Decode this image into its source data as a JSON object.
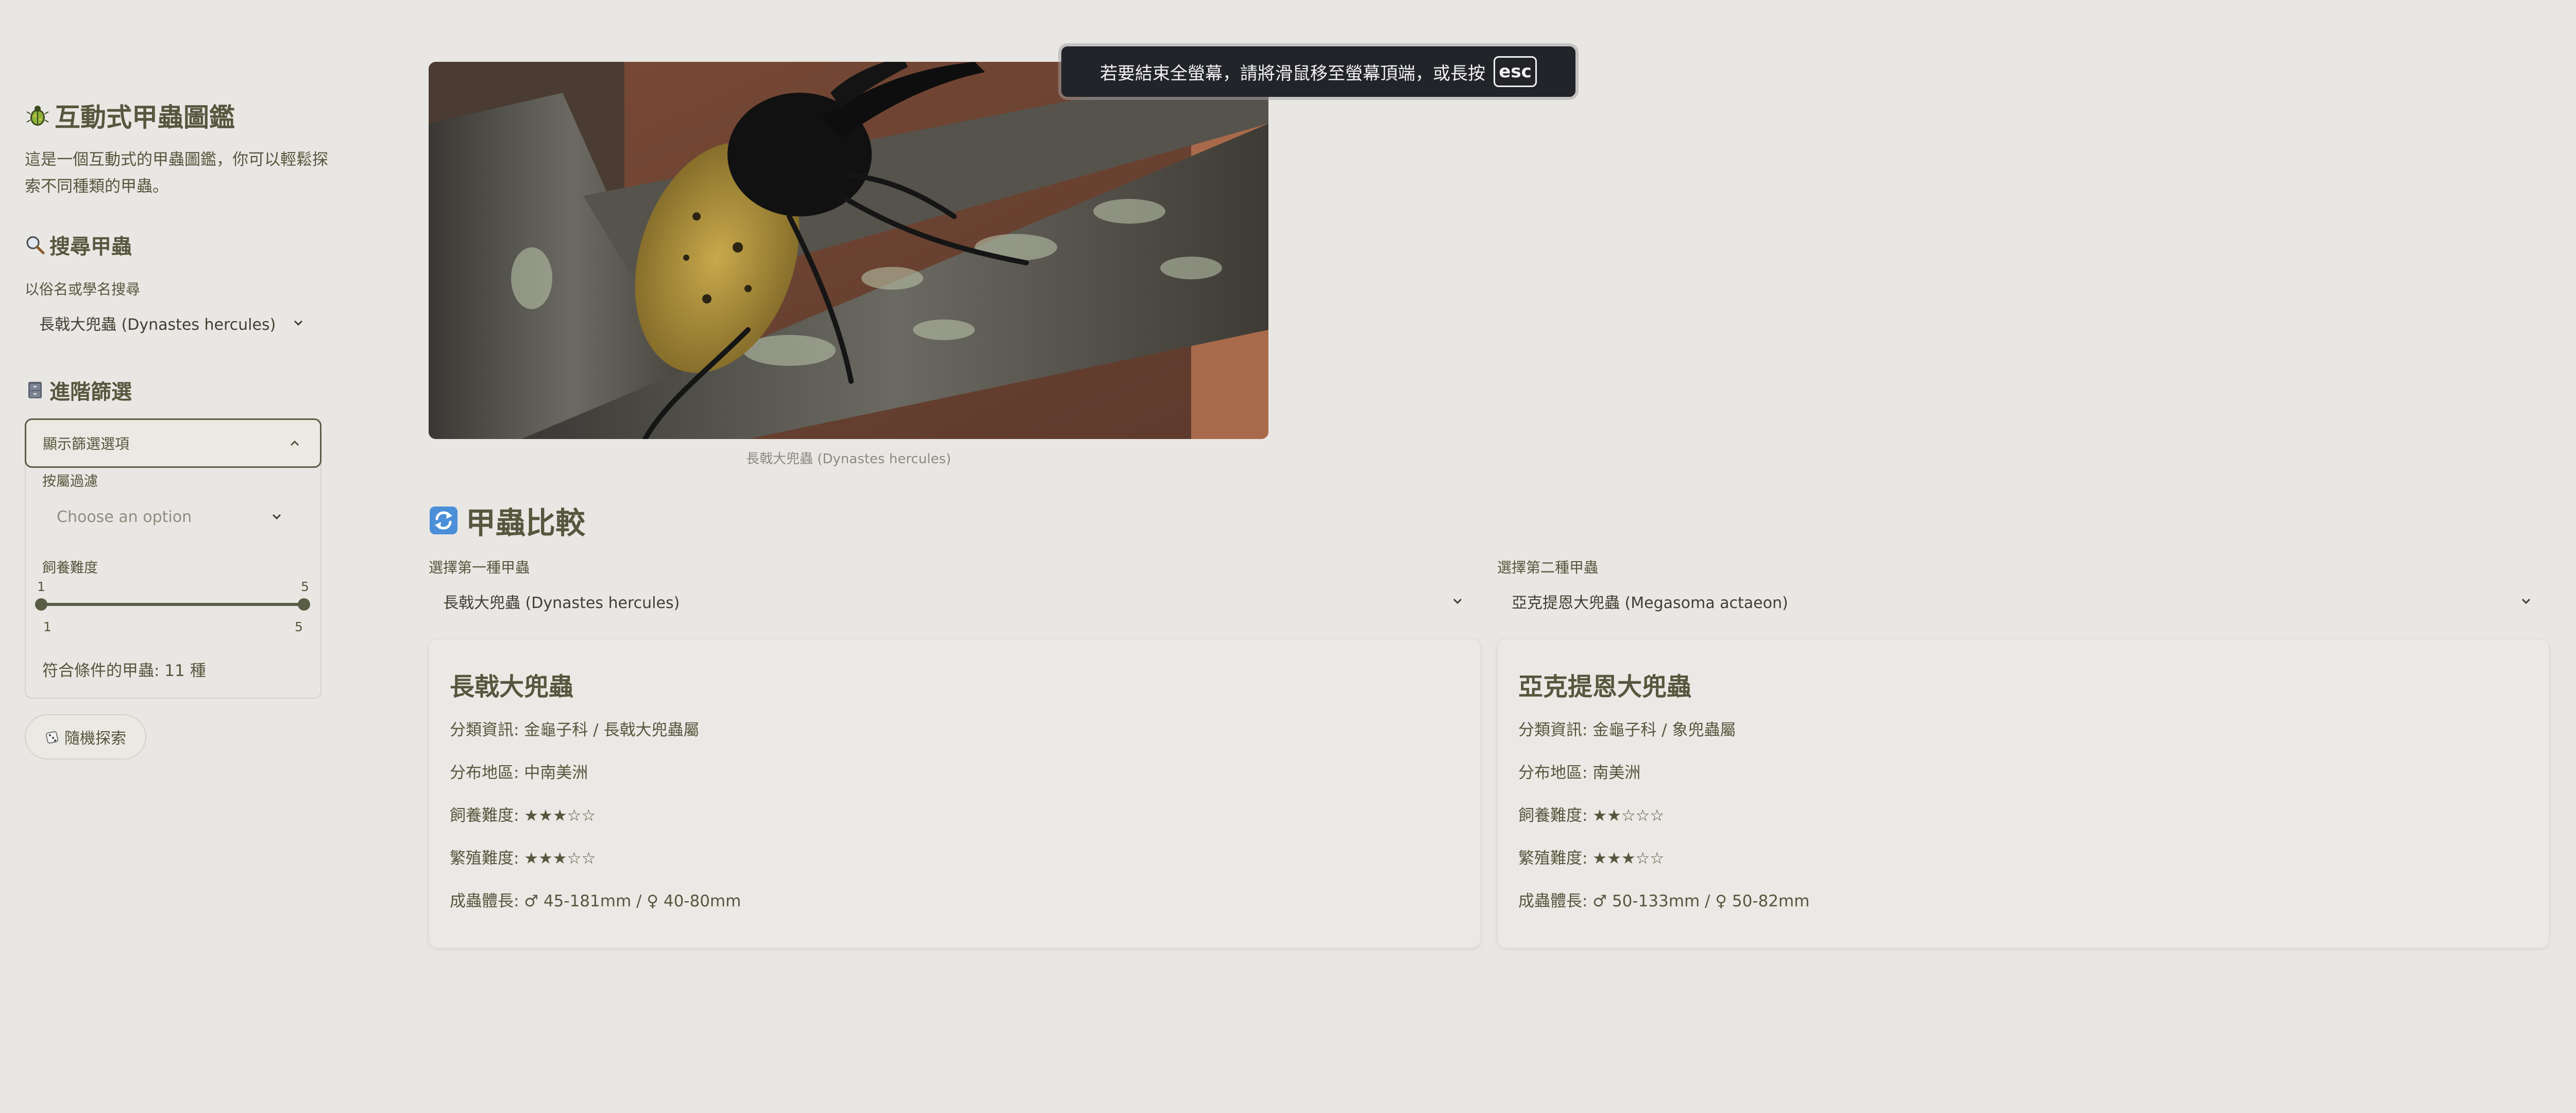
{
  "sidebar": {
    "app_title": "互動式甲蟲圖鑑",
    "app_description": "這是一個互動式的甲蟲圖鑑，你可以輕鬆探索不同種類的甲蟲。",
    "search_heading": "搜尋甲蟲",
    "search_label": "以俗名或學名搜尋",
    "search_value": "長戟大兜蟲 (Dynastes hercules)",
    "advanced_heading": "進階篩選",
    "expander_label": "顯示篩選選項",
    "genus_label": "按屬過濾",
    "genus_placeholder": "Choose an option",
    "difficulty_label": "飼養難度",
    "slider_min": 1,
    "slider_max": 5,
    "slider_low": 1,
    "slider_high": 5,
    "match_count": "符合條件的甲蟲: 11 種",
    "random_button": "隨機探索"
  },
  "main": {
    "image_caption": "長戟大兜蟲 (Dynastes hercules)",
    "compare_heading": "甲蟲比較",
    "first_select_label": "選擇第一種甲蟲",
    "first_select_value": "長戟大兜蟲 (Dynastes hercules)",
    "second_select_label": "選擇第二種甲蟲",
    "second_select_value": "亞克提恩大兜蟲 (Megasoma actaeon)",
    "cards": [
      {
        "title": "長戟大兜蟲",
        "taxonomy": "分類資訊: 金龜子科 / 長戟大兜蟲屬",
        "distribution": "分布地區: 中南美洲",
        "rearing": "飼養難度: ★★★☆☆",
        "breeding": "繁殖難度: ★★★☆☆",
        "size": "成蟲體長: ♂ 45-181mm / ♀ 40-80mm"
      },
      {
        "title": "亞克提恩大兜蟲",
        "taxonomy": "分類資訊: 金龜子科 / 象兜蟲屬",
        "distribution": "分布地區: 南美洲",
        "rearing": "飼養難度: ★★☆☆☆",
        "breeding": "繁殖難度: ★★★☆☆",
        "size": "成蟲體長: ♂ 50-133mm / ♀ 50-82mm"
      }
    ]
  },
  "overlay": {
    "fullscreen_message": "若要結束全螢幕，請將滑鼠移至螢幕頂端，或長按",
    "esc_key": "esc"
  },
  "icons": {
    "app_logo": "beetle-icon",
    "search": "magnifier-icon",
    "advanced": "file-cabinet-icon",
    "random": "dice-icon",
    "compare": "refresh-icon",
    "menu": "kebab-menu-icon"
  },
  "colors": {
    "background": "#e9e7e3",
    "accent": "#5a5d45",
    "text": "#55573e",
    "toast_bg": "#222429"
  }
}
